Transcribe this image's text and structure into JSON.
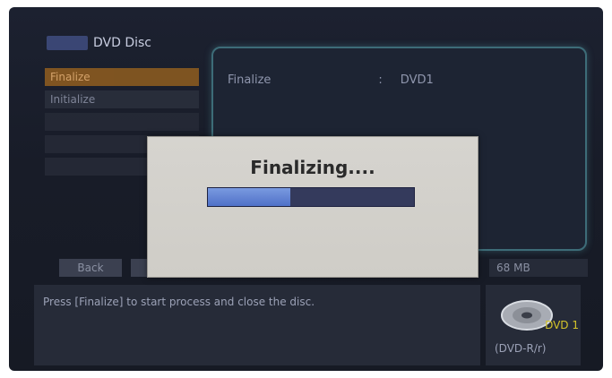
{
  "header": {
    "title": "DVD Disc"
  },
  "menu": {
    "items": [
      {
        "label": "Finalize"
      },
      {
        "label": "Initialize"
      },
      {
        "label": ""
      },
      {
        "label": ""
      },
      {
        "label": ""
      }
    ]
  },
  "info": {
    "field": "Finalize",
    "separator": ":",
    "value": "DVD1"
  },
  "bottom": {
    "back_label": "Back",
    "capacity": "68 MB"
  },
  "message": "Press [Finalize] to start process and close the disc.",
  "disc": {
    "name": "DVD 1",
    "type": "(DVD-R/r)"
  },
  "dialog": {
    "title": "Finalizing....",
    "progress": 0.4
  },
  "colors": {
    "selected": "#8a5a20",
    "panel_border": "#3d6c78",
    "progress_fill": "#4f71c8",
    "progress_bg": "#343a5c"
  }
}
